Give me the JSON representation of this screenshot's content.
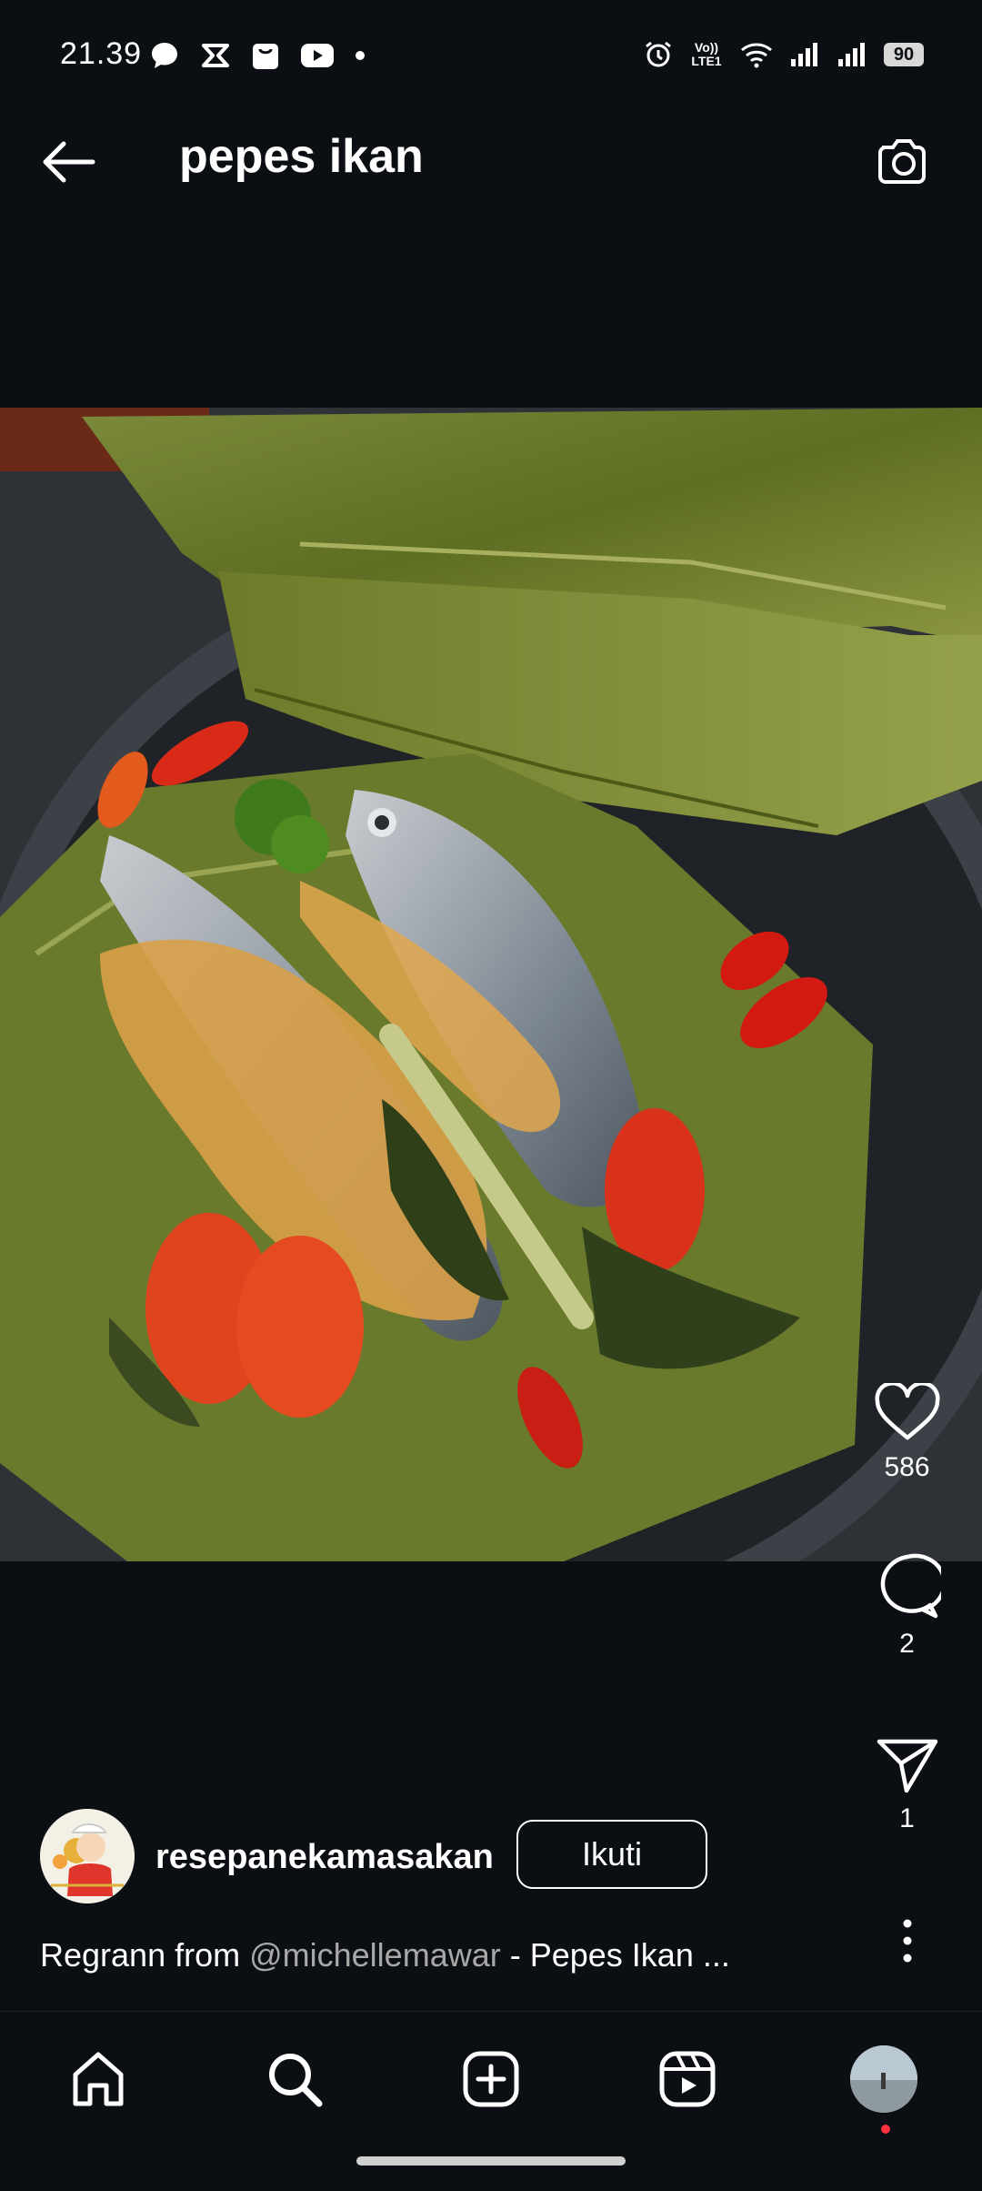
{
  "status_bar": {
    "time": "21.39",
    "network": "Vo)) LTE1",
    "battery": "90",
    "left_icons": [
      "chat-bubble-icon",
      "capcut-icon",
      "shopping-bag-icon",
      "youtube-icon",
      "dot-icon"
    ],
    "right_icons": [
      "alarm-icon",
      "volte-icon",
      "wifi-icon",
      "signal-icon",
      "signal-icon"
    ]
  },
  "header": {
    "title": "pepes ikan"
  },
  "post": {
    "image_alt": "pepes ikan",
    "likes": "586",
    "comments": "2",
    "shares": "1",
    "username": "resepanekamasakan",
    "follow_label": "Ikuti",
    "caption_prefix": "Regrann from ",
    "caption_mention": "@michellemawar",
    "caption_rest": " -  Pepes Ikan ..."
  },
  "nav": {
    "items": [
      "home-icon",
      "search-icon",
      "create-icon",
      "reels-icon",
      "profile-avatar"
    ]
  },
  "colors": {
    "background": "#0b0f14",
    "text": "#ffffff",
    "muted": "#a8a8a8",
    "notification_dot": "#ff3040"
  }
}
